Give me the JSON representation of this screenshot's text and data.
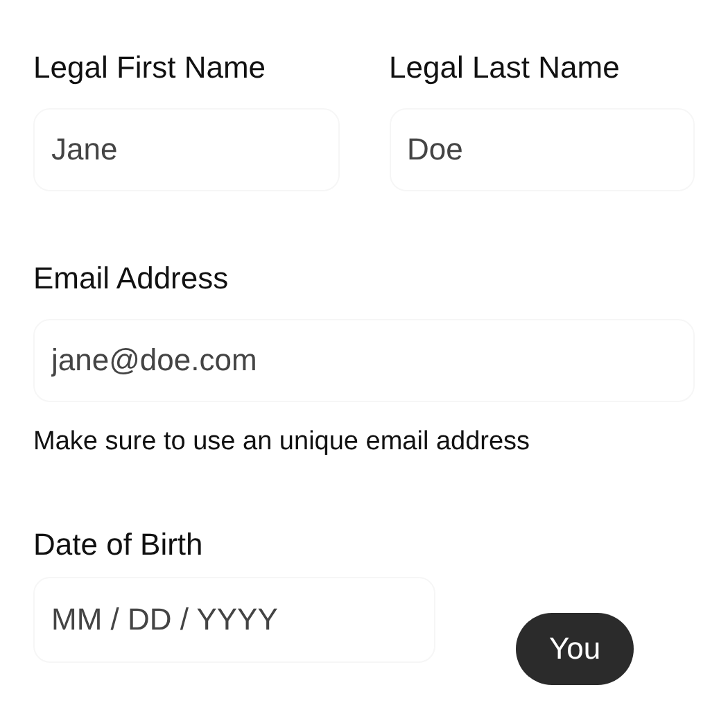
{
  "name_fields": [
    {
      "label": "Legal First Name",
      "value": "Jane"
    },
    {
      "label": "Legal Last Name",
      "value": "Doe"
    }
  ],
  "email": {
    "label": "Email Address",
    "value": "jane@doe.com",
    "hint": "Make sure to use an unique email address"
  },
  "birth_date": {
    "label": "Date of Birth",
    "placeholder": "MM / DD / YYYY"
  },
  "user_tag": "You"
}
